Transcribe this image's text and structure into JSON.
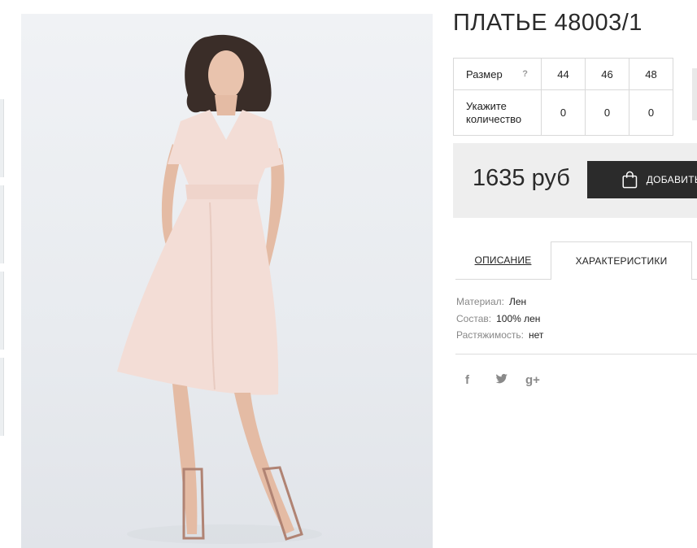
{
  "product": {
    "title": "ПЛАТЬЕ 48003/1",
    "price": "1635 руб",
    "add_to_cart_label": "ДОБАВИТЬ"
  },
  "size_table": {
    "size_label": "Размер",
    "help_label": "?",
    "sizes": [
      "44",
      "46",
      "48"
    ],
    "qty_label": "Укажите количество",
    "qty_values": [
      "0",
      "0",
      "0"
    ]
  },
  "tabs": {
    "description": "ОПИСАНИЕ",
    "characteristics": "ХАРАКТЕРИСТИКИ",
    "active": "characteristics"
  },
  "characteristics": [
    {
      "key": "Материал:",
      "value": "Лен"
    },
    {
      "key": "Состав:",
      "value": "100% лен"
    },
    {
      "key": "Растяжимость:",
      "value": "нет"
    }
  ],
  "social": [
    "f",
    "twitter",
    "g+"
  ],
  "icons": [
    "shopping-bag-icon",
    "facebook-icon",
    "twitter-icon",
    "google-plus-icon"
  ],
  "colors": {
    "dress": "#f3ddd6",
    "button": "#2b2b2b",
    "buybox": "#eeeeee"
  }
}
